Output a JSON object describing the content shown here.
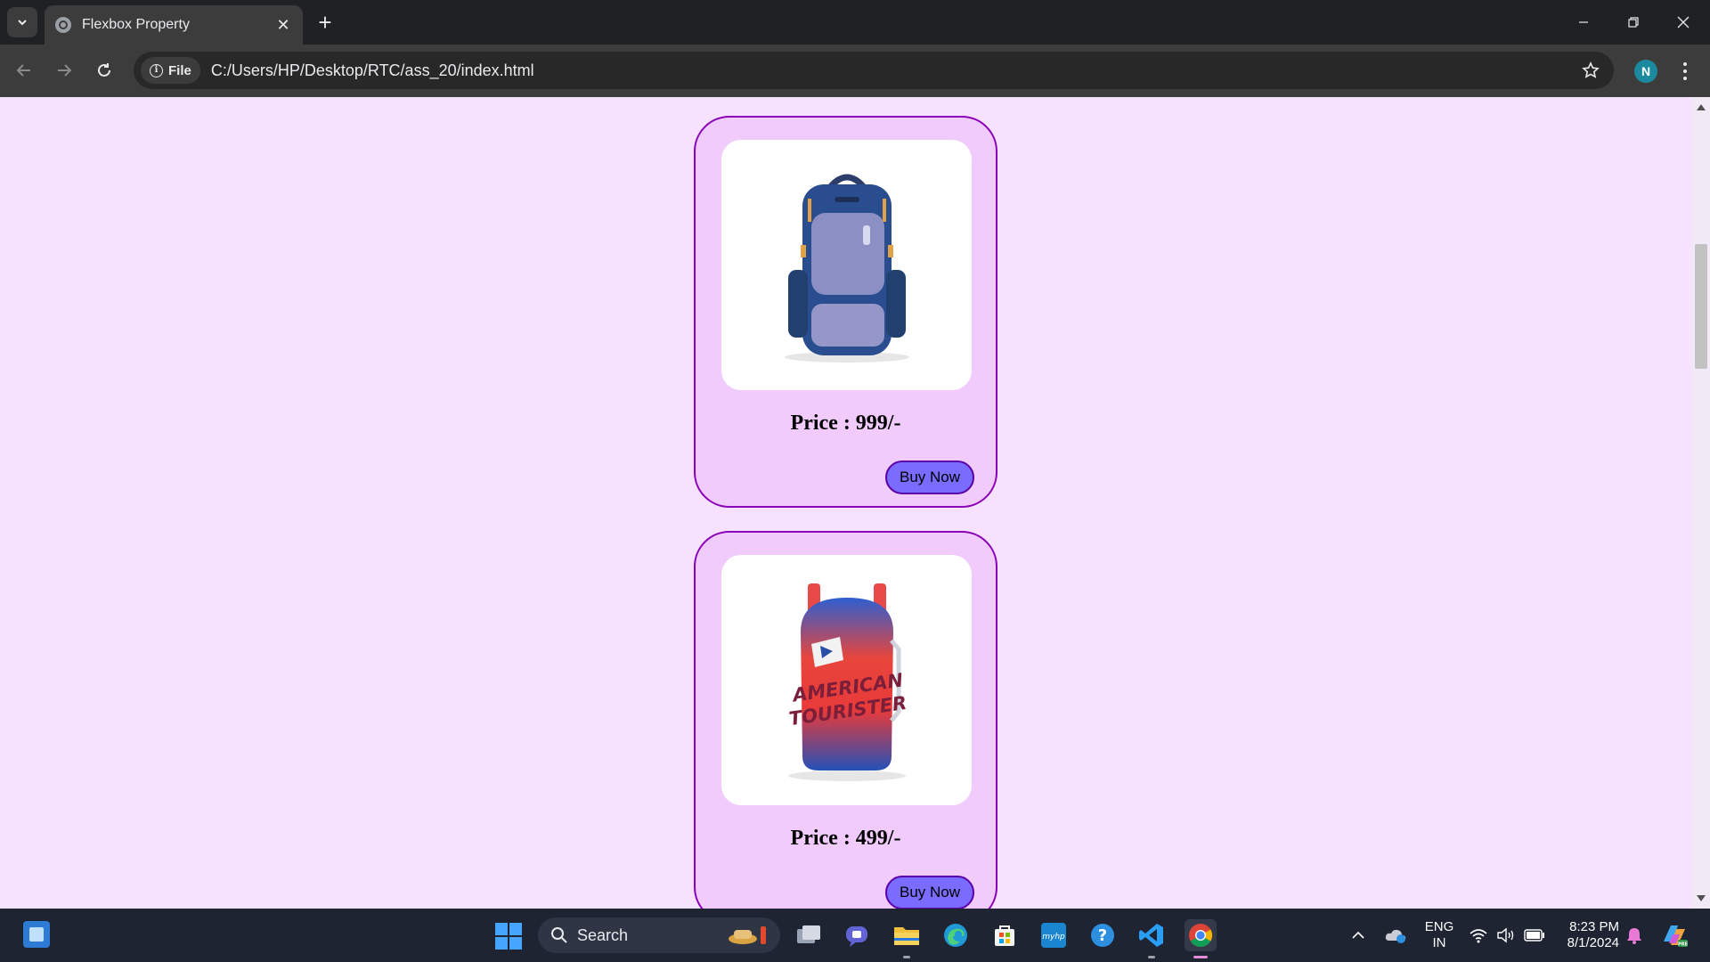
{
  "browser": {
    "tab_title": "Flexbox Property",
    "file_chip": "File",
    "url": "C:/Users/HP/Desktop/RTC/ass_20/index.html",
    "profile_initial": "N"
  },
  "page": {
    "background_color": "#f6e2ff",
    "cards": [
      {
        "image_icon": "navy-backpack-image",
        "price": "Price : 999/-",
        "button_label": "Buy Now"
      },
      {
        "image_icon": "red-blue-backpack-image",
        "image_text_line1": "AMERICAN",
        "image_text_line2": "TOURISTER",
        "price": "Price : 499/-",
        "button_label": "Buy Now"
      }
    ]
  },
  "taskbar": {
    "search_label": "Search",
    "language_line1": "ENG",
    "language_line2": "IN",
    "time": "8:23 PM",
    "date": "8/1/2024"
  },
  "colors": {
    "card_bg": "#f0cbfb",
    "card_border": "#8a00b8",
    "button_bg": "#7a6cff"
  }
}
